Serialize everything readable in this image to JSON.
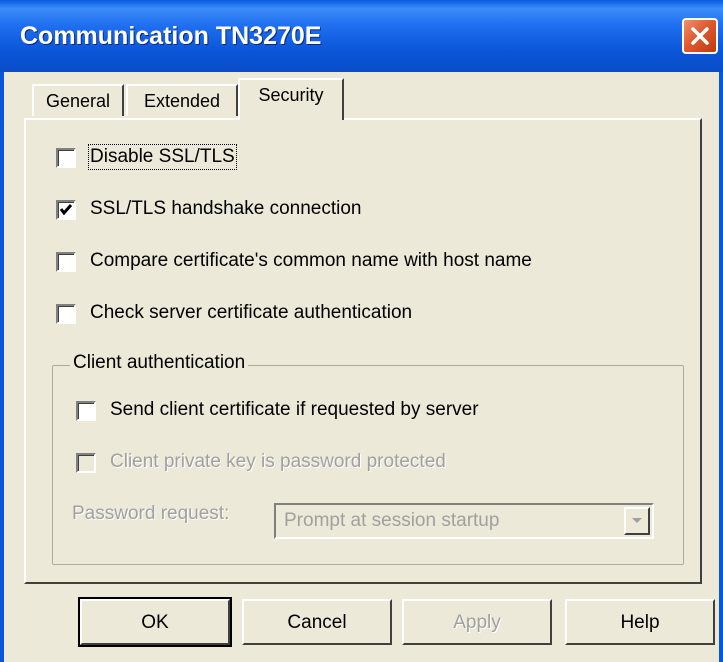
{
  "window": {
    "title": "Communication TN3270E",
    "close_icon": "close-icon"
  },
  "tabs": [
    {
      "label": "General",
      "active": false
    },
    {
      "label": "Extended",
      "active": false
    },
    {
      "label": "Security",
      "active": true
    }
  ],
  "security": {
    "disable_ssl": {
      "label": "Disable SSL/TLS",
      "checked": false,
      "enabled": true
    },
    "ssl_handshake": {
      "label": "SSL/TLS handshake connection",
      "checked": true,
      "enabled": true
    },
    "compare_cn": {
      "label": "Compare certificate's common name with host name",
      "checked": false,
      "enabled": true
    },
    "check_server_cert": {
      "label": "Check server certificate authentication",
      "checked": false,
      "enabled": true
    }
  },
  "client_auth": {
    "legend": "Client authentication",
    "send_cert": {
      "label": "Send client certificate if requested by server",
      "checked": false,
      "enabled": true
    },
    "key_protected": {
      "label": "Client private key is password protected",
      "checked": false,
      "enabled": false
    },
    "password_request": {
      "label": "Password request:",
      "value": "Prompt at session startup",
      "enabled": false
    }
  },
  "buttons": {
    "ok": "OK",
    "cancel": "Cancel",
    "apply": "Apply",
    "help": "Help"
  },
  "colors": {
    "titlebar": "#0a56d8",
    "dialog_bg": "#ece9d8",
    "disabled_text": "#a0a0a0"
  }
}
